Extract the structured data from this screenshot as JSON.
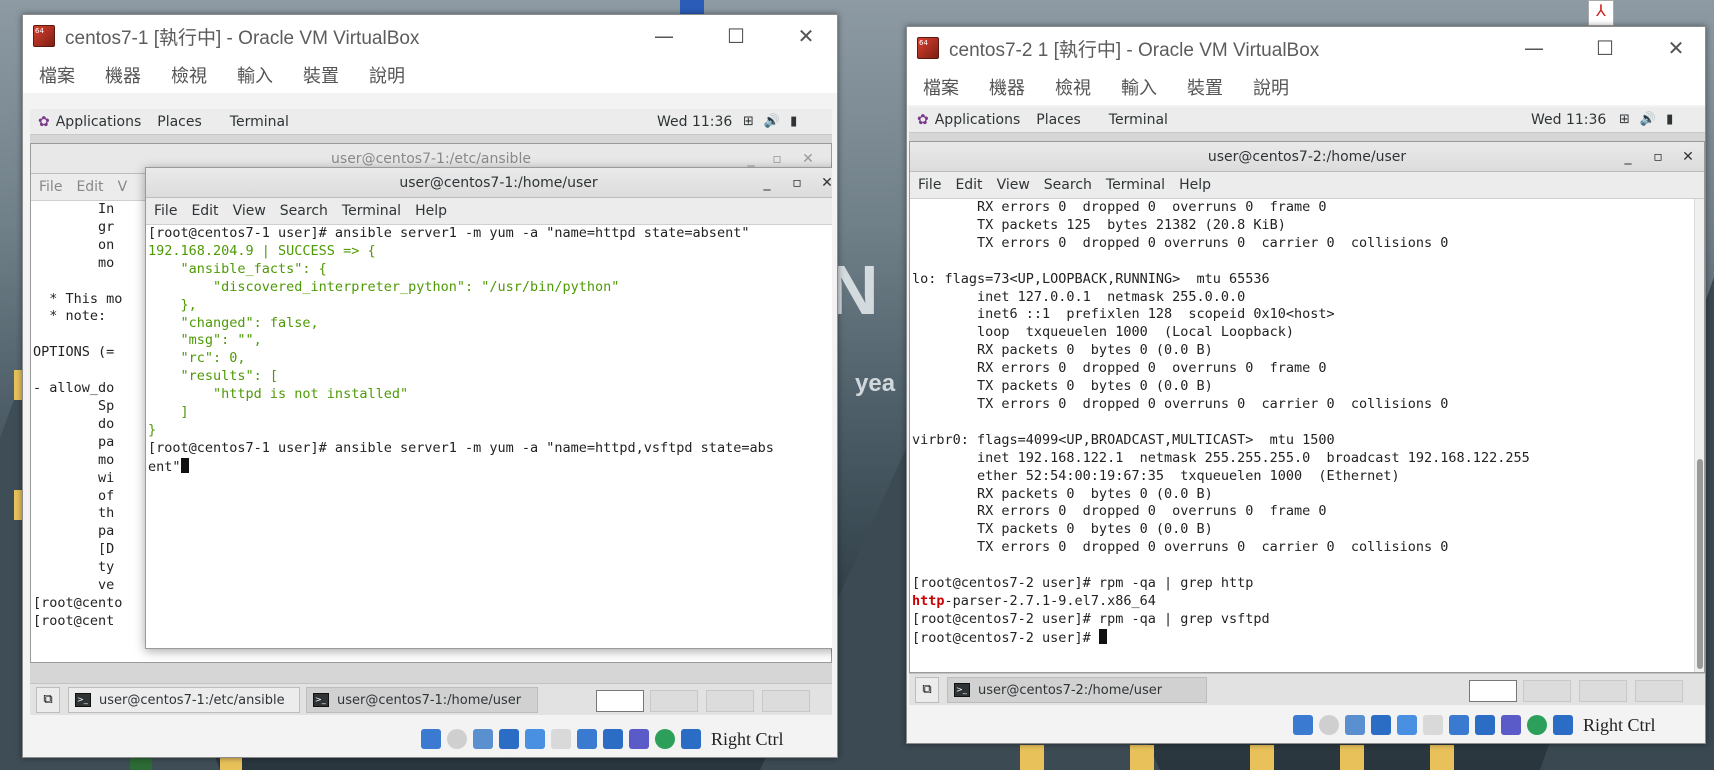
{
  "desktop": {
    "logo_letter": "N",
    "logo_word": "yea"
  },
  "vm1": {
    "title": "centos7-1 [執行中] - Oracle VM VirtualBox",
    "menu": [
      "檔案",
      "機器",
      "檢視",
      "輸入",
      "裝置",
      "說明"
    ],
    "gnome": {
      "applications": "Applications",
      "places": "Places",
      "terminal": "Terminal",
      "clock": "Wed 11:36"
    },
    "back_terminal": {
      "title": "user@centos7-1:/etc/ansible",
      "menu": [
        "File",
        "Edit",
        "V"
      ],
      "lines": [
        "        In",
        "        gr",
        "        on",
        "        mo",
        "",
        "  * This mo",
        "  * note: ",
        "",
        "OPTIONS (=",
        "",
        "- allow_do",
        "        Sp",
        "        do",
        "        pa",
        "        mo",
        "        wi",
        "        of",
        "        th",
        "        pa",
        "        [D",
        "        ty",
        "        ve",
        "[root@cento",
        "[root@cent"
      ]
    },
    "front_terminal": {
      "title": "user@centos7-1:/home/user",
      "menu": [
        "File",
        "Edit",
        "View",
        "Search",
        "Terminal",
        "Help"
      ],
      "cmd1": "[root@centos7-1 user]# ansible server1 -m yum -a \"name=httpd state=absent\"",
      "output": [
        "192.168.204.9 | SUCCESS => {",
        "    \"ansible_facts\": {",
        "        \"discovered_interpreter_python\": \"/usr/bin/python\"",
        "    },",
        "    \"changed\": false,",
        "    \"msg\": \"\",",
        "    \"rc\": 0,",
        "    \"results\": [",
        "        \"httpd is not installed\"",
        "    ]",
        "}"
      ],
      "cmd2a": "[root@centos7-1 user]# ansible server1 -m yum -a \"name=httpd,vsftpd state=abs",
      "cmd2b": "ent\""
    },
    "winlist": [
      "user@centos7-1:/etc/ansible",
      "user@centos7-1:/home/user"
    ],
    "right_ctrl": "Right Ctrl"
  },
  "vm2": {
    "title": "centos7-2 1 [執行中] - Oracle VM VirtualBox",
    "menu": [
      "檔案",
      "機器",
      "檢視",
      "輸入",
      "裝置",
      "說明"
    ],
    "gnome": {
      "applications": "Applications",
      "places": "Places",
      "terminal": "Terminal",
      "clock": "Wed 11:36"
    },
    "terminal": {
      "title": "user@centos7-2:/home/user",
      "menu": [
        "File",
        "Edit",
        "View",
        "Search",
        "Terminal",
        "Help"
      ],
      "lines": [
        "        RX errors 0  dropped 0  overruns 0  frame 0",
        "        TX packets 125  bytes 21382 (20.8 KiB)",
        "        TX errors 0  dropped 0 overruns 0  carrier 0  collisions 0",
        "",
        "lo: flags=73<UP,LOOPBACK,RUNNING>  mtu 65536",
        "        inet 127.0.0.1  netmask 255.0.0.0",
        "        inet6 ::1  prefixlen 128  scopeid 0x10<host>",
        "        loop  txqueuelen 1000  (Local Loopback)",
        "        RX packets 0  bytes 0 (0.0 B)",
        "        RX errors 0  dropped 0  overruns 0  frame 0",
        "        TX packets 0  bytes 0 (0.0 B)",
        "        TX errors 0  dropped 0 overruns 0  carrier 0  collisions 0",
        "",
        "virbr0: flags=4099<UP,BROADCAST,MULTICAST>  mtu 1500",
        "        inet 192.168.122.1  netmask 255.255.255.0  broadcast 192.168.122.255",
        "        ether 52:54:00:19:67:35  txqueuelen 1000  (Ethernet)",
        "        RX packets 0  bytes 0 (0.0 B)",
        "        RX errors 0  dropped 0  overruns 0  frame 0",
        "        TX packets 0  bytes 0 (0.0 B)",
        "        TX errors 0  dropped 0 overruns 0  carrier 0  collisions 0",
        "",
        "[root@centos7-2 user]# rpm -qa | grep http"
      ],
      "match_prefix": "http",
      "match_rest": "-parser-2.7.1-9.el7.x86_64",
      "cmd_vsftpd": "[root@centos7-2 user]# rpm -qa | grep vsftpd",
      "prompt": "[root@centos7-2 user]# "
    },
    "winlist": [
      "user@centos7-2:/home/user"
    ],
    "right_ctrl": "Right Ctrl"
  },
  "colors": {
    "prompt_green": "#4e9a06",
    "grep_match_red": "#cc0000"
  }
}
